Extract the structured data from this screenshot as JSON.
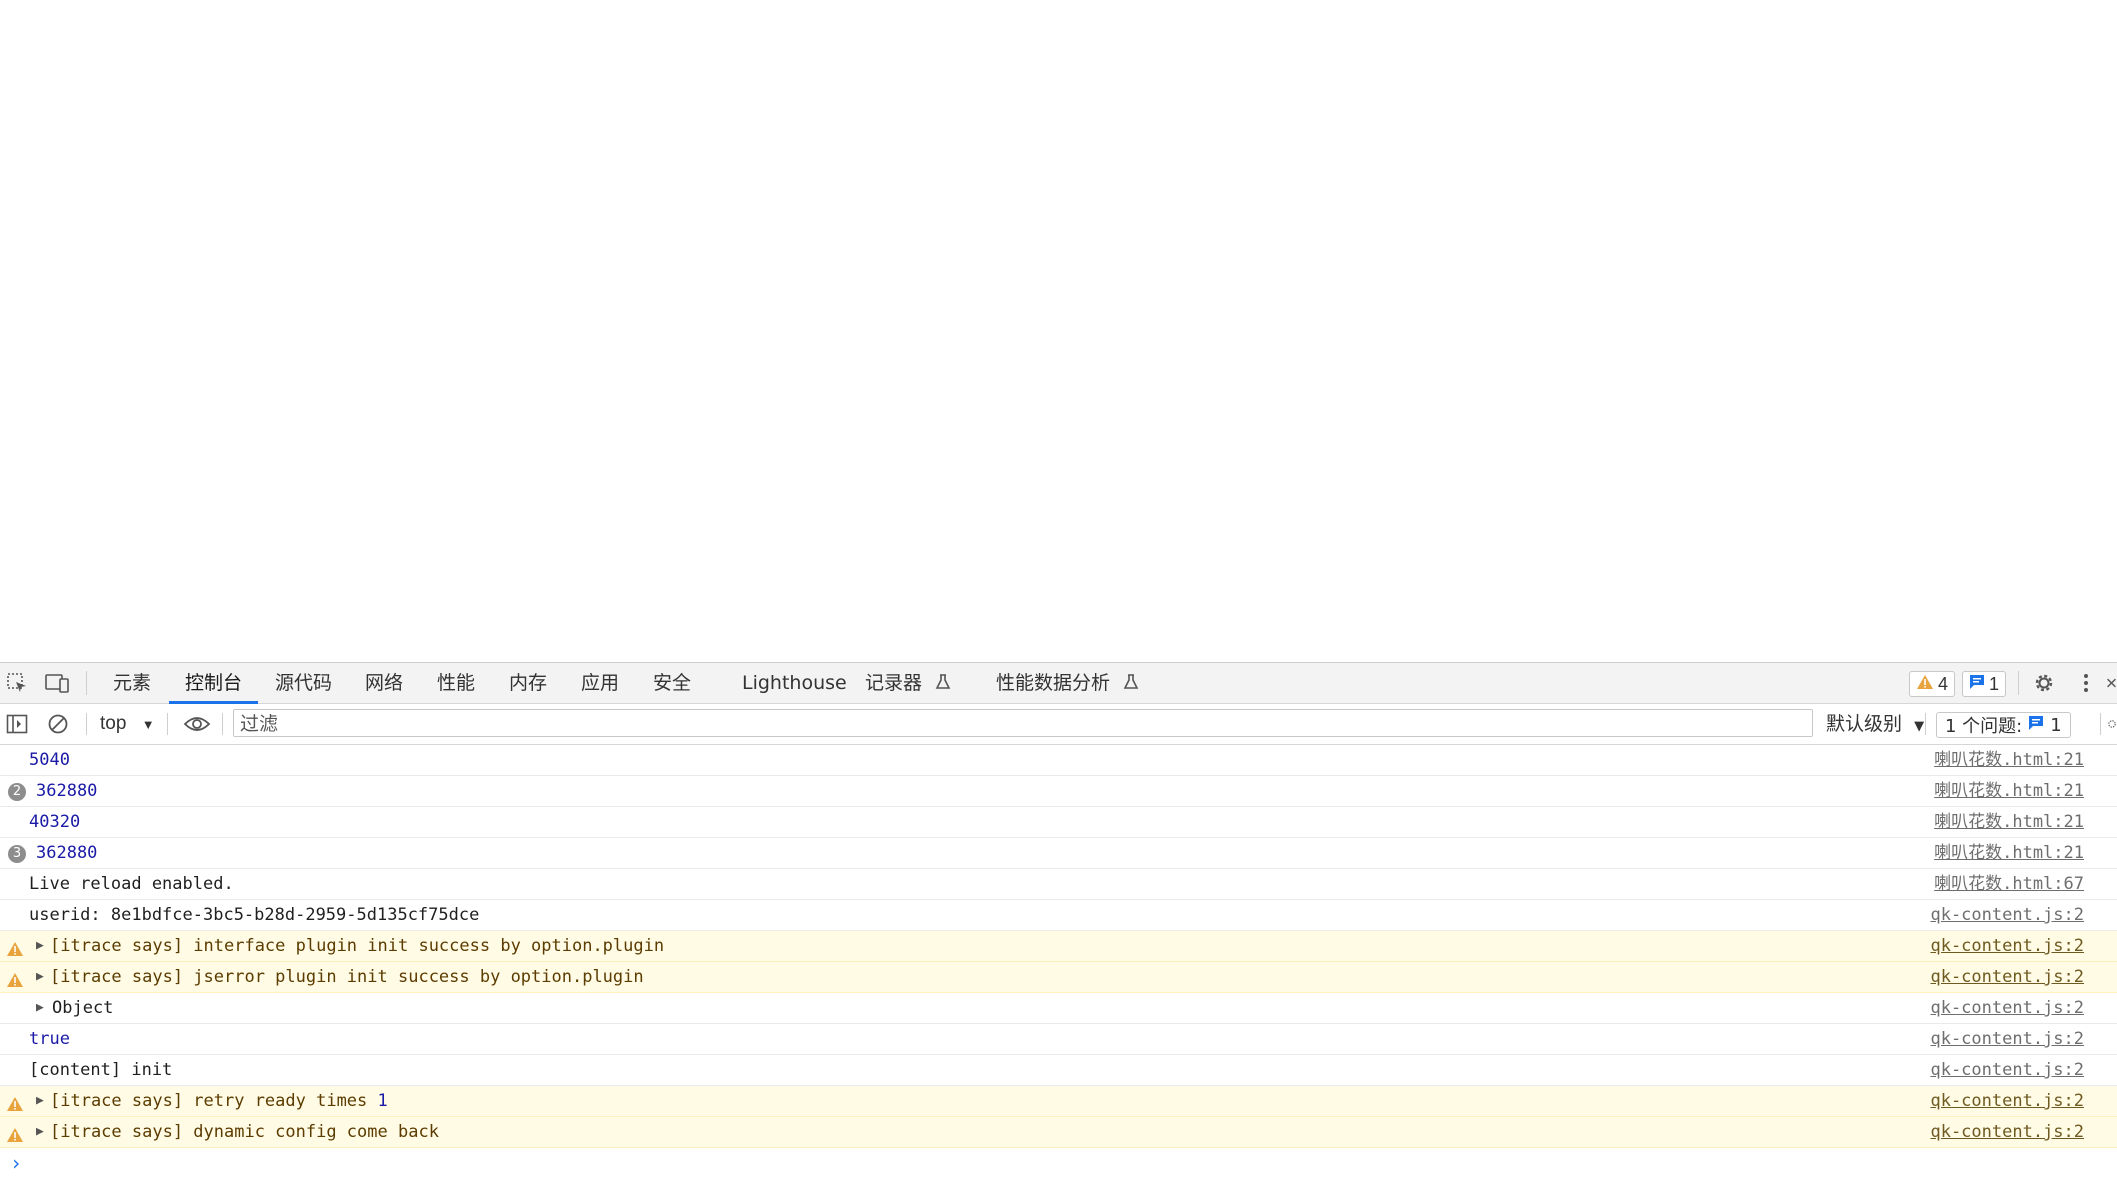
{
  "devtools": {
    "tabs": [
      {
        "label": "元素"
      },
      {
        "label": "控制台"
      },
      {
        "label": "源代码"
      },
      {
        "label": "网络"
      },
      {
        "label": "性能"
      },
      {
        "label": "内存"
      },
      {
        "label": "应用"
      },
      {
        "label": "安全"
      },
      {
        "label": "Lighthouse"
      },
      {
        "label": "记录器"
      },
      {
        "label": "性能数据分析"
      }
    ],
    "warning_count": "4",
    "message_count": "1"
  },
  "console_toolbar": {
    "context": "top",
    "filter_placeholder": "过滤",
    "level": "默认级别",
    "issues_label": "1 个问题:",
    "issues_count": "1"
  },
  "log": [
    {
      "type": "log",
      "message": "5040",
      "source": "喇叭花数.html:21"
    },
    {
      "type": "log",
      "count": "2",
      "message": "362880",
      "source": "喇叭花数.html:21"
    },
    {
      "type": "log",
      "message": "40320",
      "source": "喇叭花数.html:21"
    },
    {
      "type": "log",
      "count": "3",
      "message": "362880",
      "source": "喇叭花数.html:21"
    },
    {
      "type": "log",
      "message": "Live reload enabled.",
      "source": "喇叭花数.html:67"
    },
    {
      "type": "log",
      "message": "userid: 8e1bdfce-3bc5-b28d-2959-5d135cf75dce",
      "source": "qk-content.js:2"
    },
    {
      "type": "warn",
      "message": "[itrace says] interface plugin init success by option.plugin",
      "source": "qk-content.js:2"
    },
    {
      "type": "warn",
      "message": "[itrace says] jserror plugin init success by option.plugin",
      "source": "qk-content.js:2"
    },
    {
      "type": "log",
      "message": "Object",
      "source": "qk-content.js:2"
    },
    {
      "type": "log",
      "message": "true",
      "source": "qk-content.js:2"
    },
    {
      "type": "log",
      "message": "[content] init",
      "source": "qk-content.js:2"
    },
    {
      "type": "warn",
      "message": "[itrace says] retry ready times",
      "message_num": "1",
      "source": "qk-content.js:2"
    },
    {
      "type": "warn",
      "message": "[itrace says] dynamic config come back",
      "source": "qk-content.js:2"
    }
  ]
}
